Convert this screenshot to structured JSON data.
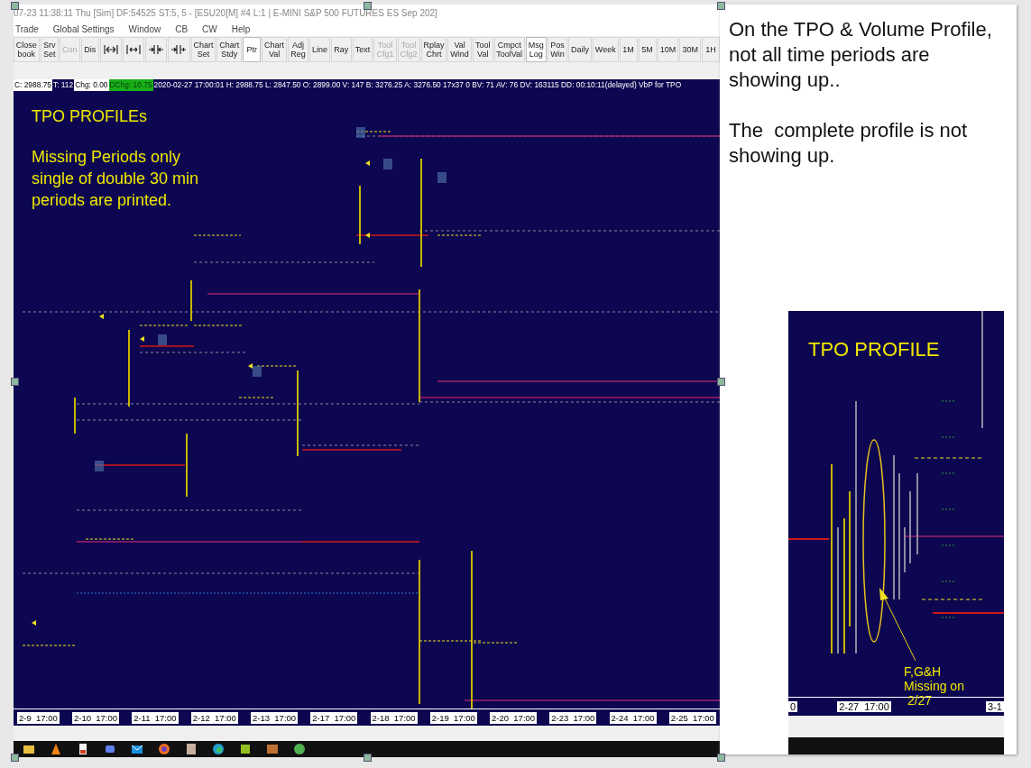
{
  "title_bar": {
    "title": "07-23  11:38:11 Thu [Sim]  DF:54525  ST:5, 5 - [ESU20[M]  #4  L:1 | E-MINI S&P 500 FUTURES ES Sep 202]"
  },
  "menu": [
    "Trade",
    "Global Settings",
    "Window",
    "CB",
    "CW",
    "Help"
  ],
  "toolbar": [
    {
      "kind": "text",
      "lines": [
        "Close",
        "book"
      ],
      "disabled": false,
      "selected": false
    },
    {
      "kind": "text",
      "lines": [
        "Srv",
        "Set"
      ],
      "disabled": false,
      "selected": false
    },
    {
      "kind": "text",
      "lines": [
        "Con"
      ],
      "disabled": true,
      "selected": false
    },
    {
      "kind": "text",
      "lines": [
        "Dis"
      ],
      "disabled": false,
      "selected": false
    },
    {
      "kind": "icon"
    },
    {
      "kind": "icon"
    },
    {
      "kind": "icon"
    },
    {
      "kind": "icon"
    },
    {
      "kind": "text",
      "lines": [
        "Chart",
        "Set"
      ],
      "disabled": false,
      "selected": false
    },
    {
      "kind": "text",
      "lines": [
        "Chart",
        "Stdy"
      ],
      "disabled": false,
      "selected": false
    },
    {
      "kind": "text",
      "lines": [
        "Ptr"
      ],
      "disabled": false,
      "selected": true
    },
    {
      "kind": "text",
      "lines": [
        "Chart",
        "Val"
      ],
      "disabled": false,
      "selected": false
    },
    {
      "kind": "text",
      "lines": [
        "Adj",
        "Reg"
      ],
      "disabled": false,
      "selected": false
    },
    {
      "kind": "text",
      "lines": [
        "Line"
      ],
      "disabled": false,
      "selected": false
    },
    {
      "kind": "text",
      "lines": [
        "Ray"
      ],
      "disabled": false,
      "selected": false
    },
    {
      "kind": "text",
      "lines": [
        "Text"
      ],
      "disabled": false,
      "selected": false
    },
    {
      "kind": "text",
      "lines": [
        "Tool",
        "Cfg1"
      ],
      "disabled": true,
      "selected": false
    },
    {
      "kind": "text",
      "lines": [
        "Tool",
        "Cfg2"
      ],
      "disabled": true,
      "selected": false
    },
    {
      "kind": "text",
      "lines": [
        "Rplay",
        "Chrt"
      ],
      "disabled": false,
      "selected": false
    },
    {
      "kind": "text",
      "lines": [
        "Val",
        "Wind"
      ],
      "disabled": false,
      "selected": false
    },
    {
      "kind": "text",
      "lines": [
        "Tool",
        "Val"
      ],
      "disabled": false,
      "selected": false
    },
    {
      "kind": "text",
      "lines": [
        "Cmpct",
        "ToolVal"
      ],
      "disabled": false,
      "selected": false
    },
    {
      "kind": "text",
      "lines": [
        "Msg",
        "Log"
      ],
      "disabled": false,
      "selected": true
    },
    {
      "kind": "text",
      "lines": [
        "Pos",
        "Win"
      ],
      "disabled": false,
      "selected": false
    },
    {
      "kind": "text",
      "lines": [
        "Daily"
      ],
      "disabled": false,
      "selected": false
    },
    {
      "kind": "text",
      "lines": [
        "Week"
      ],
      "disabled": false,
      "selected": false
    },
    {
      "kind": "text",
      "lines": [
        "1M"
      ],
      "disabled": false,
      "selected": false
    },
    {
      "kind": "text",
      "lines": [
        "5M"
      ],
      "disabled": false,
      "selected": false
    },
    {
      "kind": "text",
      "lines": [
        "10M"
      ],
      "disabled": false,
      "selected": false
    },
    {
      "kind": "text",
      "lines": [
        "30M"
      ],
      "disabled": false,
      "selected": false
    },
    {
      "kind": "text",
      "lines": [
        "1H"
      ],
      "disabled": false,
      "selected": false
    }
  ],
  "status_line": [
    {
      "kind": "light",
      "text": "C: 2988.75"
    },
    {
      "kind": "dark",
      "text": "T: 112"
    },
    {
      "kind": "light",
      "text": "Chg: 0.00"
    },
    {
      "kind": "green",
      "text": "DChg: 10.75"
    },
    {
      "kind": "dark",
      "text": "2020-02-27 17:00:01 H: 2988.75 L: 2847.50 O: 2899.00 V: 147 B: 3276.25 A: 3276.50 17x37 0 BV: 71 AV: 76 DV: 163115 DD: 00:10:11(delayed) VbP for TPO"
    }
  ],
  "chart": {
    "heading": "TPO PROFILEs",
    "note": "Missing Periods only single of double 30 min periods are printed.",
    "dates": [
      "2-9  17:00",
      "2-10  17:00",
      "2-11  17:00",
      "2-12  17:00",
      "2-13  17:00",
      "2-17  17:00",
      "2-18  17:00",
      "2-19  17:00",
      "2-20  17:00",
      "2-23  17:00",
      "2-24  17:00",
      "2-25  17:00"
    ]
  },
  "notes": [
    "On the TPO & Volume Profile, not all time periods are showing up..",
    "The  complete profile is not showing up."
  ],
  "inset": {
    "heading": "TPO PROFILE",
    "callout": "F,G&H\nMissing on\n 2/27",
    "dates": [
      "0",
      "2-27  17:00",
      "3-1"
    ]
  }
}
